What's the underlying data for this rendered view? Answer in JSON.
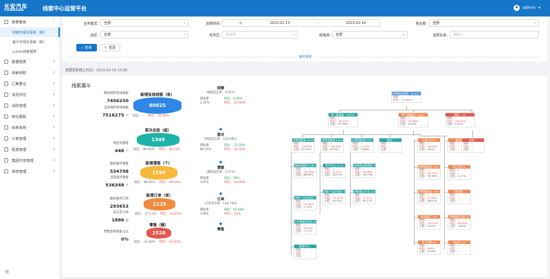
{
  "header": {
    "logo_cn": "长安汽车",
    "logo_en": "CHANGAN",
    "title": "线索中心运营平台",
    "user": "admin"
  },
  "sidebar": {
    "items": [
      {
        "label": "数据看板",
        "arrow": "^"
      },
      {
        "label": "线索可视化看板（新）",
        "sub": true,
        "active": true
      },
      {
        "label": "客户可视化看板（新）",
        "sub": true
      },
      {
        "label": "Lumin线索报表",
        "sub": true
      },
      {
        "label": "数据报表",
        "arrow": "v"
      },
      {
        "label": "线索获取",
        "arrow": "v"
      },
      {
        "label": "汇聚整合",
        "arrow": "v"
      },
      {
        "label": "清洗评估",
        "arrow": "v"
      },
      {
        "label": "战败管理",
        "arrow": "v"
      },
      {
        "label": "转化跟踪",
        "arrow": "v"
      },
      {
        "label": "线单系统",
        "arrow": "v"
      },
      {
        "label": "订单管理",
        "arrow": "v"
      },
      {
        "label": "配置管理",
        "arrow": "v"
      },
      {
        "label": "集团共享管理",
        "arrow": "v"
      },
      {
        "label": "系统管理",
        "arrow": "v"
      }
    ],
    "collapse_icon": "☰"
  },
  "filters": {
    "business_mode_label": "业务模式:",
    "business_mode": "全部",
    "time_label": "选择时间:",
    "date_start": "2023-02-13",
    "date_sep": "-",
    "date_end": "2023-02-14",
    "division_label": "事业部:",
    "division": "全部",
    "region_label": "战区:",
    "region": "全部",
    "province_label": "省市区:",
    "province_placeholder": "请选择",
    "channel_label": "经销商:",
    "channel": "全部",
    "car_series_label": "选择车系:",
    "car_series_placeholder": "请输入",
    "query_btn": "查询",
    "reset_btn": "重置",
    "expand": "展开查询"
  },
  "deadline": "数据更新截止时间：2023-02-14 13:00",
  "panel": {
    "title": "线索漏斗"
  },
  "left_stats": [
    {
      "label": "期初线存有效线索",
      "value": "7456250"
    },
    {
      "label": "当前线存有效线索",
      "value": "7516275"
    },
    {
      "label": "待首次建客",
      "value": "448"
    },
    {
      "label": "期初留存潜客",
      "value": "534798"
    },
    {
      "label": "当前留存潜客",
      "value": "536348"
    },
    {
      "label": "期初留存订单",
      "value": "293653"
    },
    {
      "label": "未交车订单",
      "value": "1886"
    },
    {
      "label": "零售获得线索占比",
      "value": "0%"
    }
  ],
  "units": [
    "个",
    "个",
    "个",
    "单"
  ],
  "funnel": [
    {
      "title": "新增有效线索（条）",
      "value": "60025",
      "color": "#2f86e6",
      "yoy": "同比：--",
      "mom": "环比：-31.64%"
    },
    {
      "title": "首次总投（组）",
      "value": "1349",
      "color": "#1fb2a8",
      "yoy": "同比：-89.60%",
      "mom": "环比：-38.21%"
    },
    {
      "title": "新增潜客（个）",
      "value": "1550",
      "color": "#f5b838",
      "yoy": "同比：-88.82%",
      "mom": "环比：-44.04%"
    },
    {
      "title": "新增订单（单）",
      "value": "2129",
      "color": "#f08a3c",
      "yoy": "同比：-37.11%",
      "mom": "环比：-53.87%"
    },
    {
      "title": "零售（辆）",
      "value": "2528",
      "color": "#e5574d",
      "yoy": "同比：-31.80%",
      "mom": "环比：-53.81%"
    }
  ],
  "stages": [
    {
      "name": "线索",
      "sub": "（线索成交率：0.05%）",
      "rate_label": "转化率",
      "rate": "2.25%",
      "yoy": "同比：0.00%",
      "mom": "环比：-22.00%"
    },
    {
      "name": "首次",
      "sub": "（到店成交率：140.68%）",
      "rate_label": "转化率",
      "rate": "86.25%",
      "yoy": "同比：-21.00%",
      "mom": "环比：-32.00%"
    },
    {
      "name": "潜客",
      "sub": "（潜客成交率：2.47%）",
      "rate_label": "转化率",
      "rate": "137%",
      "yoy": "同比：28%",
      "mom": "环比：-18.00%"
    },
    {
      "name": "订单",
      "sub": "（订单交付率：118.74%）",
      "rate_label": "转化率",
      "rate": "119%",
      "yoy": "同比：55.00%",
      "mom": "环比：-22%"
    },
    {
      "name": "零售",
      "sub": "",
      "rate_label": "",
      "rate": "",
      "yoy": "",
      "mom": ""
    }
  ],
  "tree": {
    "root": {
      "title": "新增有效线索：60025",
      "l1": "同比：--",
      "l2": "环比：-31.64%"
    },
    "online": {
      "title": "线上渠道量：56392",
      "l1": "同比：--",
      "l2": "环比：-33.47%",
      "l3": "占比：93.95%"
    },
    "offline": {
      "title": "线下渠道量：3619",
      "l1": "同比：--",
      "l2": "环比：25.66%",
      "l3": "占比：6.03%"
    },
    "other": {
      "title": "其他：14",
      "l1": "同比：--",
      "l2": "环比：-28.32%",
      "l3": "占比：0.02%"
    },
    "online_children": [
      {
        "title": "官营线索源",
        "val": "49187",
        "l1": "同比：--",
        "l2": "环比：-29.99%",
        "l3": "占比：87.22%"
      },
      {
        "title": "商营线索源",
        "val": "4958",
        "l1": "同比：--",
        "l2": "环比：-59.43%",
        "l3": "占比：8.79%"
      },
      {
        "title": "自营线索源",
        "val": "2247",
        "l1": "同比：--",
        "l2": "环比：-0.73%",
        "l3": "占比：3.98%"
      },
      {
        "title": "其他",
        "val": "--",
        "l1": "同比：--",
        "l2": "环比：--",
        "l3": "占比：--"
      }
    ],
    "col1": [
      {
        "title": "集团线索库",
        "val": "43677",
        "l1": "同比：--",
        "l2": "环比：-30.93%",
        "l3": "占比：88.80%"
      },
      {
        "title": "线索广告位投放（媒体）",
        "val": "579",
        "l1": "同比：--",
        "l2": "环比：15.76%",
        "l3": "占比：1.70%"
      },
      {
        "title": "IOP营销号同步",
        "val": "871",
        "l1": "同比：--",
        "l2": "环比：-8.21%",
        "l3": "占比：1.77%"
      },
      {
        "title": "直营平台",
        "val": "--",
        "l1": "同比：--",
        "l2": "环比：--",
        "l3": "占比：--"
      }
    ],
    "col2": [
      {
        "title": "官方平台",
        "val": "2279",
        "l1": "同比：--",
        "l2": "环比：-8.41%",
        "l3": "占比：45.97%"
      },
      {
        "title": "线索广告位投放（媒体）",
        "val": "2679",
        "l1": "同比：--",
        "l2": "环比：-72.67%",
        "l3": "占比：54.03%"
      }
    ],
    "col3": [
      {
        "title": "经销商自营营销",
        "val": "376",
        "l1": "同比：--",
        "l2": "环比：14.98%",
        "l3": "占比：16.73%"
      },
      {
        "title": "经销商公众号",
        "val": "1871",
        "l1": "同比：--",
        "l2": "环比：-3.41%",
        "l3": "占比：83.27%"
      }
    ],
    "off1": [
      {
        "title": "自然",
        "val": "3023",
        "l1": "同比：--",
        "l2": "环比：18.43%",
        "l3": "占比：100%"
      },
      {
        "title": "经销商来电",
        "val": "1421",
        "l1": "同比：--",
        "l2": "环比：18.33%",
        "l3": "占比：39.39%"
      },
      {
        "title": "经销商来店",
        "val": "1397",
        "l1": "同比：--",
        "l2": "环比：27.89%",
        "l3": "占比：38.61%"
      },
      {
        "title": "新车展示",
        "val": "105",
        "l1": "同比：--",
        "l2": "环比：-18.12%",
        "l3": "占比：4.64%"
      },
      {
        "title": "线下团购",
        "val": "34",
        "l1": "同比：--",
        "l2": "环比：567%",
        "l3": "占比：0.93%"
      }
    ],
    "off2": [
      {
        "title": "其他",
        "val": "--",
        "l1": "同比：--",
        "l2": "环比：--",
        "l3": "占比：--"
      },
      {
        "title": "线下活动",
        "val": "6",
        "l1": "同比：--",
        "l2": "环比：--",
        "l3": "占比：0.17%"
      },
      {
        "title": "二网线索",
        "val": "--",
        "l1": "同比：--",
        "l2": "环比：--",
        "l3": "占比：--"
      },
      {
        "title": "经销商外拓展",
        "val": "33",
        "l1": "同比：--",
        "l2": "环比：76.92%",
        "l3": "占比：1.85%"
      },
      {
        "title": "跨店中",
        "val": "34",
        "l1": "同比：--",
        "l2": "环比：--",
        "l3": "占比：--"
      }
    ],
    "other_child": {
      "title": "其他",
      "val": "--",
      "l1": "同比：--",
      "l2": "环比：--",
      "l3": "占比：--"
    }
  }
}
